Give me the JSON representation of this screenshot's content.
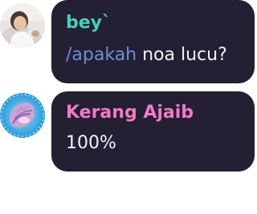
{
  "messages": [
    {
      "author": "bey`",
      "command": "/apakah",
      "text": " noa lucu?",
      "author_color": "#44d3b8",
      "avatar_icon": "user-photo-avatar"
    },
    {
      "author": "Kerang Ajaib",
      "text": "100%",
      "author_color": "#f07ac6",
      "avatar_icon": "conch-shell-avatar"
    }
  ],
  "colors": {
    "bubble_bg": "#241f33",
    "message_text": "#f4f3f7",
    "command_text": "#6f8ed8"
  }
}
